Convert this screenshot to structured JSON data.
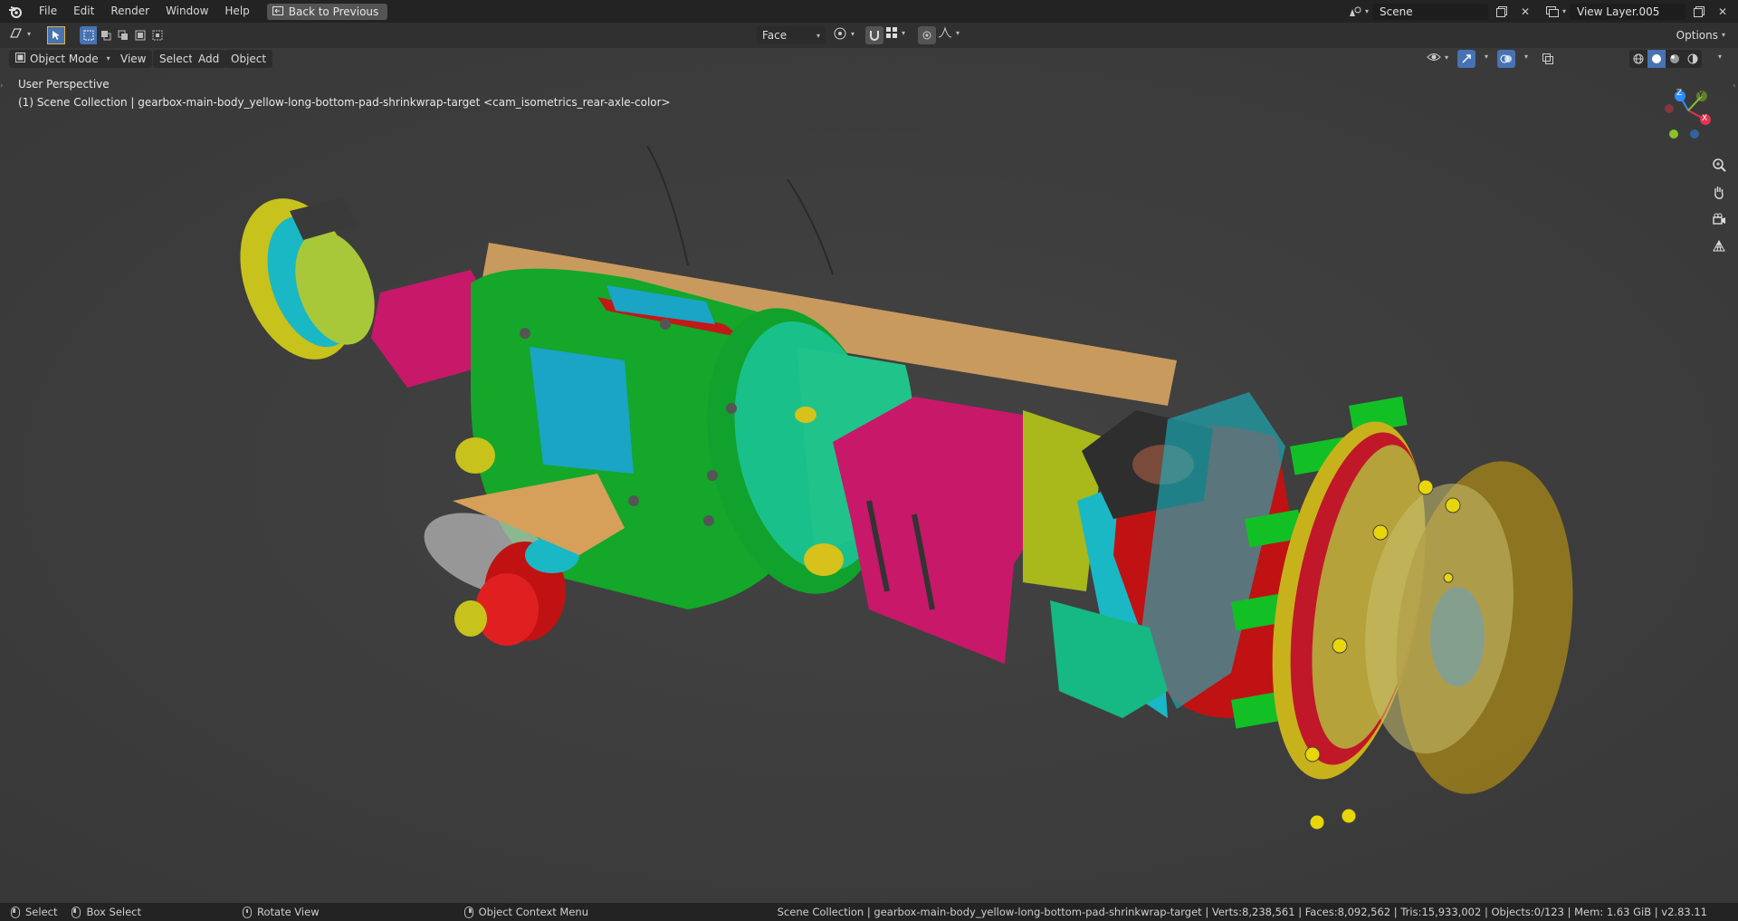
{
  "menubar": {
    "items": [
      "File",
      "Edit",
      "Render",
      "Window",
      "Help"
    ],
    "back_button": "Back to Previous"
  },
  "scene": {
    "label": "Scene",
    "view_layer": "View Layer.005"
  },
  "toolheader": {
    "select_mode": "Face",
    "options_label": "Options"
  },
  "viewheader": {
    "mode": "Object Mode",
    "menus": [
      "View",
      "Select",
      "Add",
      "Object"
    ]
  },
  "overlay": {
    "perspective": "User Perspective",
    "collection_info": "(1) Scene Collection | gearbox-main-body_yellow-long-bottom-pad-shrinkwrap-target <cam_isometrics_rear-axle-color>"
  },
  "gizmo": {
    "x": "X",
    "y": "Y",
    "z": "Z"
  },
  "statusbar": {
    "select": "Select",
    "box_select": "Box Select",
    "rotate_view": "Rotate View",
    "context_menu": "Object Context Menu",
    "stats": "Scene Collection | gearbox-main-body_yellow-long-bottom-pad-shrinkwrap-target | Verts:8,238,561 | Faces:8,092,562 | Tris:15,933,002 | Objects:0/123 | Mem: 1.63 GiB | v2.83.11"
  },
  "colors": {
    "background": "#3d3d3d",
    "topbar": "#232323",
    "accent": "#4772b3",
    "x_axis": "#e0344f",
    "y_axis": "#8ac22b",
    "z_axis": "#2c8fff"
  },
  "icons": [
    "blender-logo-icon",
    "back-icon",
    "scene-icon",
    "view-layer-icon",
    "cursor-icon",
    "select-box-icon",
    "pivot-icon",
    "snap-icon",
    "proportional-icon",
    "visibility-icon",
    "gizmo-icon",
    "overlay-icon",
    "xray-icon",
    "shading-wire-icon",
    "shading-solid-icon",
    "shading-material-icon",
    "shading-render-icon",
    "zoom-icon",
    "hand-icon",
    "camera-icon",
    "grid-icon"
  ]
}
